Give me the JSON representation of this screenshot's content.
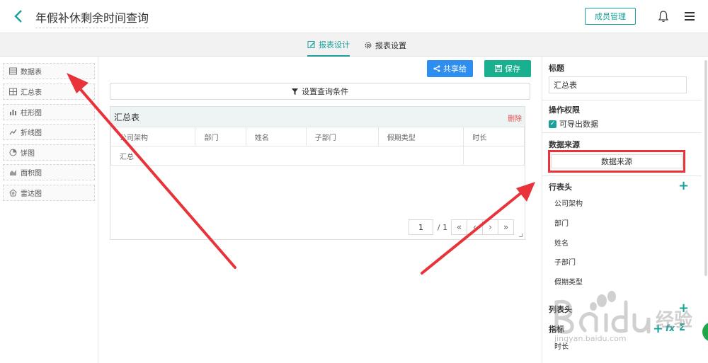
{
  "header": {
    "title": "年假补休剩余时间查询",
    "members_button": "成员管理",
    "back_icon": "chevron-left-icon",
    "bell_icon": "bell-icon",
    "menu_icon": "hamburger-icon"
  },
  "tabs": [
    {
      "label": "报表设计",
      "active": true,
      "icon": "edit-icon"
    },
    {
      "label": "报表设置",
      "active": false,
      "icon": "gear-icon"
    }
  ],
  "sidebar": {
    "items": [
      {
        "label": "数据表",
        "icon": "table-icon"
      },
      {
        "label": "汇总表",
        "icon": "summary-table-icon"
      },
      {
        "label": "柱形图",
        "icon": "bar-chart-icon"
      },
      {
        "label": "折线图",
        "icon": "line-chart-icon"
      },
      {
        "label": "饼图",
        "icon": "pie-chart-icon"
      },
      {
        "label": "面积图",
        "icon": "area-chart-icon"
      },
      {
        "label": "雷达图",
        "icon": "radar-chart-icon"
      }
    ]
  },
  "toolbar": {
    "share_label": "共享给",
    "save_label": "保存",
    "query_label": "设置查询条件"
  },
  "report": {
    "title": "汇总表",
    "delete_label": "删除",
    "columns": [
      "公司架构",
      "部门",
      "姓名",
      "子部门",
      "假期类型",
      "时长"
    ],
    "summary_row_label": "汇总",
    "pager": {
      "current": "1",
      "total": "/ 1",
      "first": "«",
      "prev": "‹",
      "next": "›",
      "last": "»"
    }
  },
  "right_panel": {
    "title_label": "标题",
    "title_value": "汇总表",
    "permission_label": "操作权限",
    "export_label": "可导出数据",
    "datasource_label": "数据来源",
    "datasource_button": "数据来源",
    "row_header_label": "行表头",
    "row_headers": [
      "公司架构",
      "部门",
      "姓名",
      "子部门",
      "假期类型"
    ],
    "col_header_label": "列表头",
    "metrics_label": "指标",
    "metrics": [
      "时长"
    ]
  },
  "watermark": {
    "text": "jingyan.baidu.com"
  },
  "colors": {
    "accent": "#19a09a",
    "share_button": "#2d8ef0",
    "save_button": "#19b08f",
    "annotation": "#e8333a"
  }
}
